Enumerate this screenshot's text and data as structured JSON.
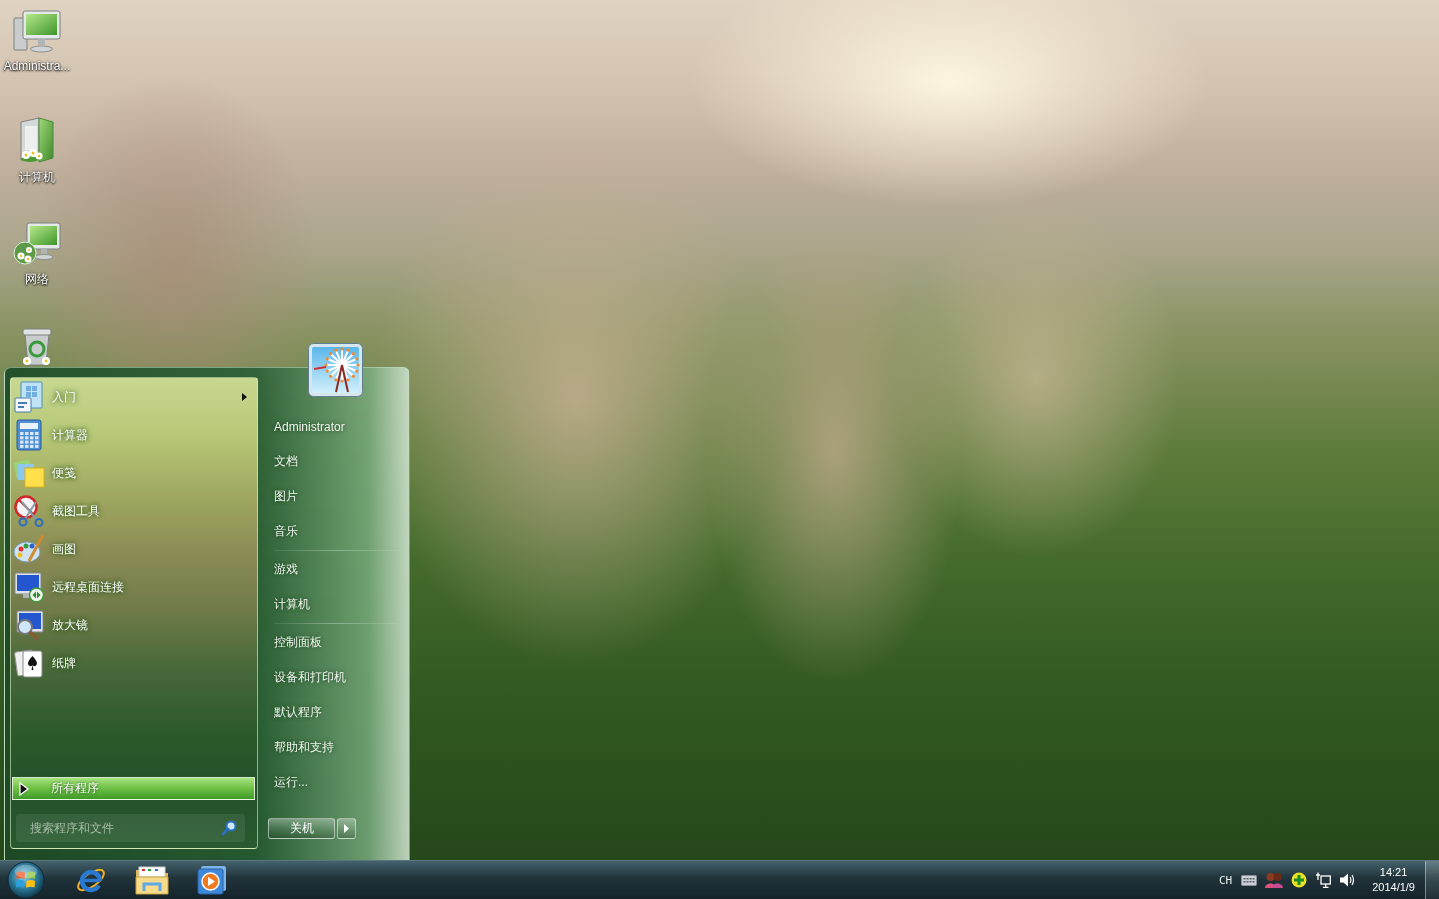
{
  "desktop_icons": [
    {
      "kind": "user-computer",
      "label": "Administra..."
    },
    {
      "kind": "computer",
      "label": "计算机"
    },
    {
      "kind": "network",
      "label": "网络"
    },
    {
      "kind": "recycle-bin"
    }
  ],
  "start_menu": {
    "programs": [
      {
        "kind": "getting-started",
        "label": "入门",
        "submenu": true
      },
      {
        "kind": "calculator",
        "label": "计算器",
        "submenu": false
      },
      {
        "kind": "sticky-notes",
        "label": "便笺",
        "submenu": false
      },
      {
        "kind": "snipping-tool",
        "label": "截图工具",
        "submenu": false
      },
      {
        "kind": "paint",
        "label": "画图",
        "submenu": false
      },
      {
        "kind": "remote-desktop",
        "label": "远程桌面连接",
        "submenu": false
      },
      {
        "kind": "magnifier",
        "label": "放大镜",
        "submenu": false
      },
      {
        "kind": "solitaire",
        "label": "纸牌",
        "submenu": false
      }
    ],
    "all_programs": "所有程序",
    "search": {
      "placeholder": "搜索程序和文件"
    },
    "place_groups": [
      {
        "items": [
          "Administrator",
          "文档",
          "图片",
          "音乐"
        ]
      },
      {
        "items": [
          "游戏",
          "计算机"
        ]
      },
      {
        "items": [
          "控制面板",
          "设备和打印机",
          "默认程序",
          "帮助和支持",
          "运行..."
        ]
      }
    ],
    "shutdown": {
      "label": "关机"
    }
  },
  "taskbar": {
    "pinned": [
      {
        "kind": "internet-explorer"
      },
      {
        "kind": "file-explorer"
      },
      {
        "kind": "media-player"
      }
    ],
    "tray": {
      "language": "CH",
      "icons": [
        {
          "kind": "keyboard"
        },
        {
          "kind": "people"
        },
        {
          "kind": "plus"
        },
        {
          "kind": "network"
        },
        {
          "kind": "volume"
        }
      ],
      "time": "14:21",
      "date": "2014/1/9"
    }
  }
}
